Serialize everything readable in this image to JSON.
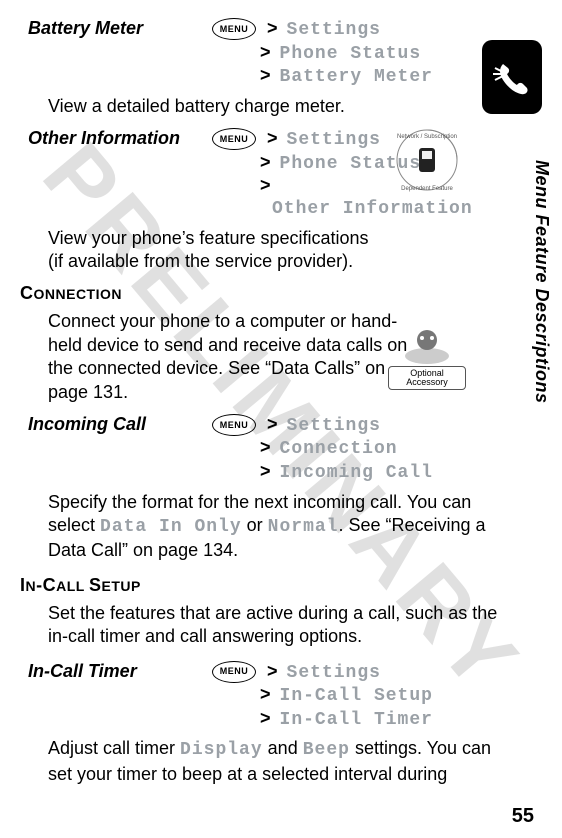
{
  "side_label": "Menu Feature Descriptions",
  "page_number": "55",
  "watermark": "PRELIMINARY",
  "menu_key": "MENU",
  "opt_accessory_label": "Optional Accessory",
  "entries": {
    "battery_meter": {
      "label": "Battery Meter",
      "path": [
        "Settings",
        "Phone Status",
        "Battery Meter"
      ],
      "body": "View a detailed battery charge meter."
    },
    "other_info": {
      "label": "Other Information",
      "path": [
        "Settings",
        "Phone Status",
        "",
        "Other Information"
      ],
      "body1": "View your phone’s feature specifications",
      "body2": "(if available from the service provider)."
    },
    "incoming_call": {
      "label": "Incoming Call",
      "path": [
        "Settings",
        "Connection",
        "Incoming Call"
      ]
    },
    "incall_timer": {
      "label": "In-Call Timer",
      "path": [
        "Settings",
        "In-Call Setup",
        "In-Call Timer"
      ]
    }
  },
  "sections": {
    "connection": {
      "heading_html": "Connection",
      "body": "Connect your phone to a computer or hand-held device to send and receive data calls on the connected device. See “Data Calls” on page 131."
    },
    "incoming_body_pre": "Specify the format for the next incoming call. You can select ",
    "incoming_opt1": "Data In Only",
    "incoming_mid": " or ",
    "incoming_opt2": "Normal",
    "incoming_post": ". See “Receiving a Data Call” on page 134.",
    "incall_setup": {
      "heading": "In-Call Setup",
      "body": "Set the features that are active during a call, such as the in-call timer and call answering options."
    },
    "incall_timer_body_pre": "Adjust call timer ",
    "incall_timer_opt1": "Display",
    "incall_timer_mid": " and ",
    "incall_timer_opt2": "Beep",
    "incall_timer_post": " settings. You can set your timer to beep at a selected interval during"
  }
}
